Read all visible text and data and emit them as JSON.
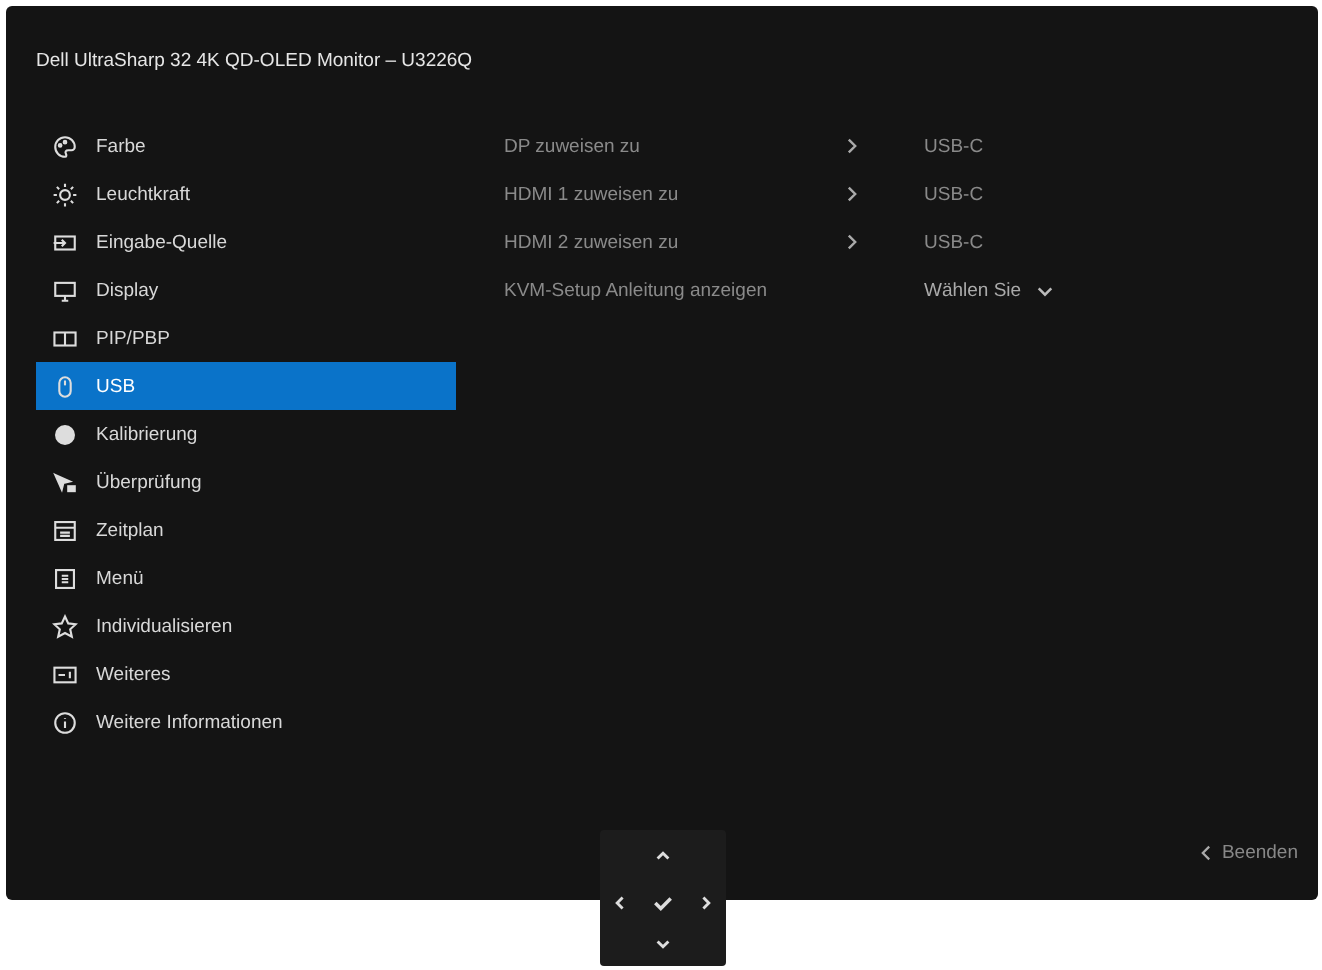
{
  "window": {
    "title": "Dell UltraSharp 32 4K QD-OLED Monitor – U3226Q"
  },
  "menu": [
    {
      "label": "Farbe",
      "selected": false
    },
    {
      "label": "Leuchtkraft",
      "selected": false
    },
    {
      "label": "Eingabe-Quelle",
      "selected": false
    },
    {
      "label": "Display",
      "selected": false
    },
    {
      "label": "PIP/PBP",
      "selected": false
    },
    {
      "label": "USB",
      "selected": true
    },
    {
      "label": "Kalibrierung",
      "selected": false
    },
    {
      "label": "Überprüfung",
      "selected": false
    },
    {
      "label": "Zeitplan",
      "selected": false
    },
    {
      "label": "Menü",
      "selected": false
    },
    {
      "label": "Individualisieren",
      "selected": false
    },
    {
      "label": "Weiteres",
      "selected": false
    },
    {
      "label": "Weitere Informationen",
      "selected": false
    }
  ],
  "settings": [
    {
      "kind": "submenu",
      "label": "DP zuweisen zu",
      "value": "USB-C"
    },
    {
      "kind": "submenu",
      "label": "HDMI 1 zuweisen zu",
      "value": "USB-C"
    },
    {
      "kind": "submenu",
      "label": "HDMI 2 zuweisen zu",
      "value": "USB-C"
    },
    {
      "kind": "dropdown",
      "label": "KVM-Setup Anleitung anzeigen",
      "value": "Wählen Sie"
    }
  ],
  "exit": {
    "label": "Beenden"
  }
}
